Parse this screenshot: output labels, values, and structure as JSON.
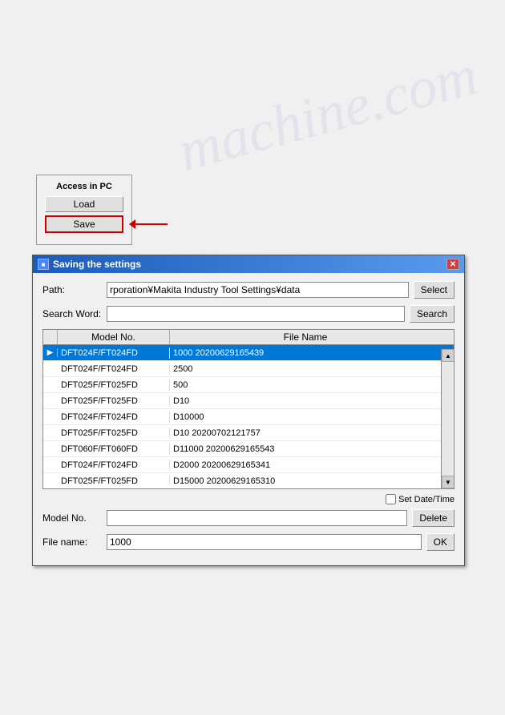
{
  "watermark": {
    "text": "machine.com"
  },
  "access_panel": {
    "title": "Access in PC",
    "load_label": "Load",
    "save_label": "Save"
  },
  "dialog": {
    "title": "Saving the settings",
    "path_label": "Path:",
    "path_value": "rporation¥Makita Industry Tool Settings¥data",
    "select_label": "Select",
    "search_word_label": "Search Word:",
    "search_label": "Search",
    "table": {
      "col_model": "Model No.",
      "col_filename": "File Name",
      "rows": [
        {
          "index": "",
          "arrow": "▶",
          "model": "DFT024F/FT024FD",
          "filename": "1000 20200629165439",
          "selected": true
        },
        {
          "index": "",
          "arrow": "",
          "model": "DFT024F/FT024FD",
          "filename": "2500",
          "selected": false
        },
        {
          "index": "",
          "arrow": "",
          "model": "DFT025F/FT025FD",
          "filename": "500",
          "selected": false
        },
        {
          "index": "",
          "arrow": "",
          "model": "DFT025F/FT025FD",
          "filename": "D10",
          "selected": false
        },
        {
          "index": "",
          "arrow": "",
          "model": "DFT024F/FT024FD",
          "filename": "D10000",
          "selected": false
        },
        {
          "index": "",
          "arrow": "",
          "model": "DFT025F/FT025FD",
          "filename": "D10 20200702121757",
          "selected": false
        },
        {
          "index": "",
          "arrow": "",
          "model": "DFT060F/FT060FD",
          "filename": "D11000 20200629165543",
          "selected": false
        },
        {
          "index": "",
          "arrow": "",
          "model": "DFT024F/FT024FD",
          "filename": "D2000 20200629165341",
          "selected": false
        },
        {
          "index": "",
          "arrow": "",
          "model": "DFT025F/FT025FD",
          "filename": "D15000 20200629165310",
          "selected": false
        }
      ]
    },
    "set_datetime_label": "Set Date/Time",
    "model_no_label": "Model No.",
    "model_no_value": "",
    "delete_label": "Delete",
    "file_name_label": "File name:",
    "file_name_value": "1000",
    "ok_label": "OK"
  }
}
